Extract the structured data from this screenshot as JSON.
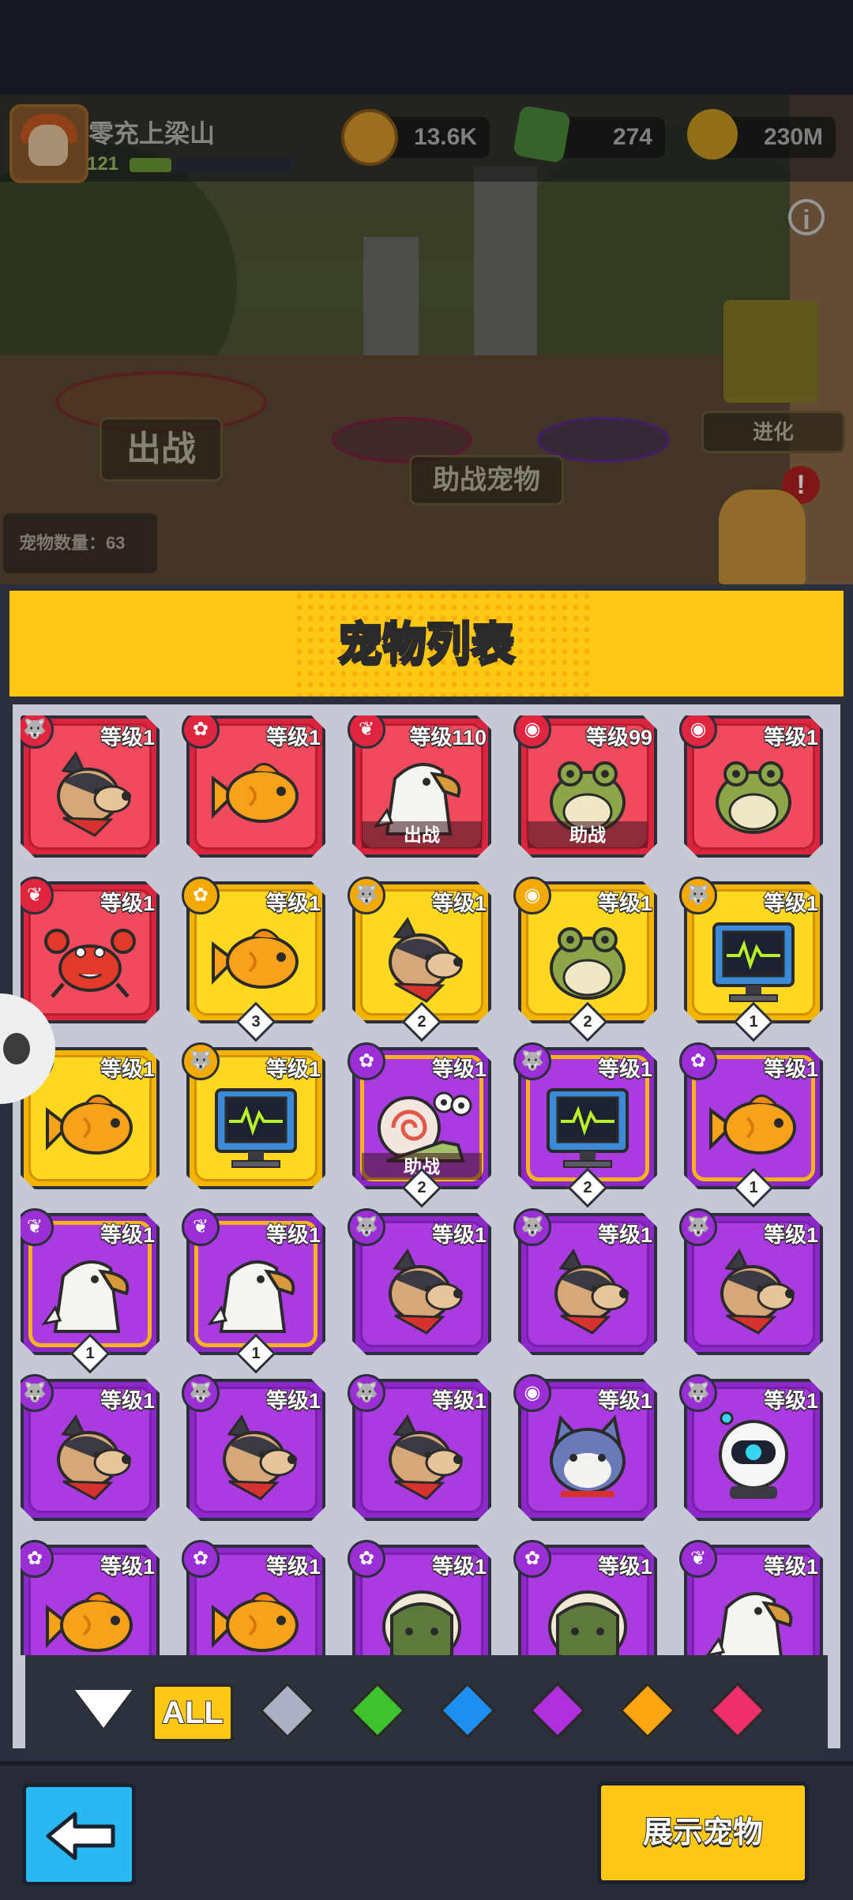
{
  "hud": {
    "player_name": "零充上梁山",
    "player_level": "121",
    "xp_fraction": 0.25,
    "currencies": [
      {
        "name": "coin-icon",
        "value": "13.6K"
      },
      {
        "name": "gem-plus-icon",
        "value": "274"
      },
      {
        "name": "gold-plus-icon",
        "value": "230M"
      }
    ]
  },
  "scene": {
    "battle_label": "出战",
    "assist_label": "助战宠物",
    "evolve_label": "进化",
    "pet_count": "宠物数量：63",
    "alert": "!",
    "info": "i"
  },
  "panel": {
    "title": "宠物列表"
  },
  "pets": [
    {
      "rarity": "red",
      "type": "dog-type-icon",
      "level": "等级1",
      "pet": "dog"
    },
    {
      "rarity": "red",
      "type": "turtle-type-icon",
      "level": "等级1",
      "pet": "fish"
    },
    {
      "rarity": "red",
      "type": "eagle-type-icon",
      "level": "等级110",
      "pet": "eagle",
      "status": "出战"
    },
    {
      "rarity": "red",
      "type": "coin-type-icon",
      "level": "等级99",
      "pet": "frog",
      "status": "助战"
    },
    {
      "rarity": "red",
      "type": "coin-type-icon",
      "level": "等级1",
      "pet": "frog"
    },
    {
      "rarity": "red",
      "type": "eagle-type-icon",
      "level": "等级1",
      "pet": "crab"
    },
    {
      "rarity": "gold",
      "type": "turtle-type-icon",
      "level": "等级1",
      "pet": "fish",
      "stars": "3"
    },
    {
      "rarity": "gold",
      "type": "dog-type-icon",
      "level": "等级1",
      "pet": "dog",
      "stars": "2"
    },
    {
      "rarity": "gold",
      "type": "coin-type-icon",
      "level": "等级1",
      "pet": "frog",
      "stars": "2"
    },
    {
      "rarity": "gold",
      "type": "dog-type-icon",
      "level": "等级1",
      "pet": "monitor",
      "stars": "1"
    },
    {
      "rarity": "gold",
      "type": "turtle-type-icon",
      "level": "等级1",
      "pet": "fish"
    },
    {
      "rarity": "gold",
      "type": "dog-type-icon",
      "level": "等级1",
      "pet": "monitor"
    },
    {
      "rarity": "purple",
      "type": "turtle-type-icon",
      "level": "等级1",
      "pet": "snail",
      "status": "助战",
      "stars": "2",
      "highlight": true
    },
    {
      "rarity": "purple",
      "type": "dog-type-icon",
      "level": "等级1",
      "pet": "monitor",
      "stars": "2",
      "highlight": true
    },
    {
      "rarity": "purple",
      "type": "turtle-type-icon",
      "level": "等级1",
      "pet": "fish",
      "stars": "1",
      "highlight": true
    },
    {
      "rarity": "purple",
      "type": "eagle-type-icon",
      "level": "等级1",
      "pet": "eagle",
      "stars": "1",
      "highlight": true
    },
    {
      "rarity": "purple",
      "type": "eagle-type-icon",
      "level": "等级1",
      "pet": "eagle",
      "stars": "1",
      "highlight": true
    },
    {
      "rarity": "purple",
      "type": "dog-type-icon",
      "level": "等级1",
      "pet": "dog"
    },
    {
      "rarity": "purple",
      "type": "dog-type-icon",
      "level": "等级1",
      "pet": "dog"
    },
    {
      "rarity": "purple",
      "type": "dog-type-icon",
      "level": "等级1",
      "pet": "dog"
    },
    {
      "rarity": "purple",
      "type": "dog-type-icon",
      "level": "等级1",
      "pet": "dog"
    },
    {
      "rarity": "purple",
      "type": "dog-type-icon",
      "level": "等级1",
      "pet": "dog"
    },
    {
      "rarity": "purple",
      "type": "dog-type-icon",
      "level": "等级1",
      "pet": "dog"
    },
    {
      "rarity": "purple",
      "type": "coin-type-icon",
      "level": "等级1",
      "pet": "cat"
    },
    {
      "rarity": "purple",
      "type": "dog-type-icon",
      "level": "等级1",
      "pet": "robot"
    },
    {
      "rarity": "purple",
      "type": "turtle-type-icon",
      "level": "等级1",
      "pet": "fish"
    },
    {
      "rarity": "purple",
      "type": "turtle-type-icon",
      "level": "等级1",
      "pet": "fish"
    },
    {
      "rarity": "purple",
      "type": "turtle-type-icon",
      "level": "等级1",
      "pet": "turtle"
    },
    {
      "rarity": "purple",
      "type": "turtle-type-icon",
      "level": "等级1",
      "pet": "turtle"
    },
    {
      "rarity": "purple",
      "type": "eagle-type-icon",
      "level": "等级1",
      "pet": "eagle"
    }
  ],
  "filters": {
    "all_label": "ALL",
    "gems": [
      {
        "name": "gray-gem-icon",
        "color": "#aab0c6"
      },
      {
        "name": "green-gem-icon",
        "color": "#3ec22e"
      },
      {
        "name": "blue-gem-icon",
        "color": "#1e8ef0"
      },
      {
        "name": "purple-gem-icon",
        "color": "#b030e0"
      },
      {
        "name": "orange-gem-icon",
        "color": "#ffa510"
      },
      {
        "name": "red-gem-icon",
        "color": "#f0306a"
      }
    ]
  },
  "footer": {
    "show_pet_label": "展示宠物"
  }
}
